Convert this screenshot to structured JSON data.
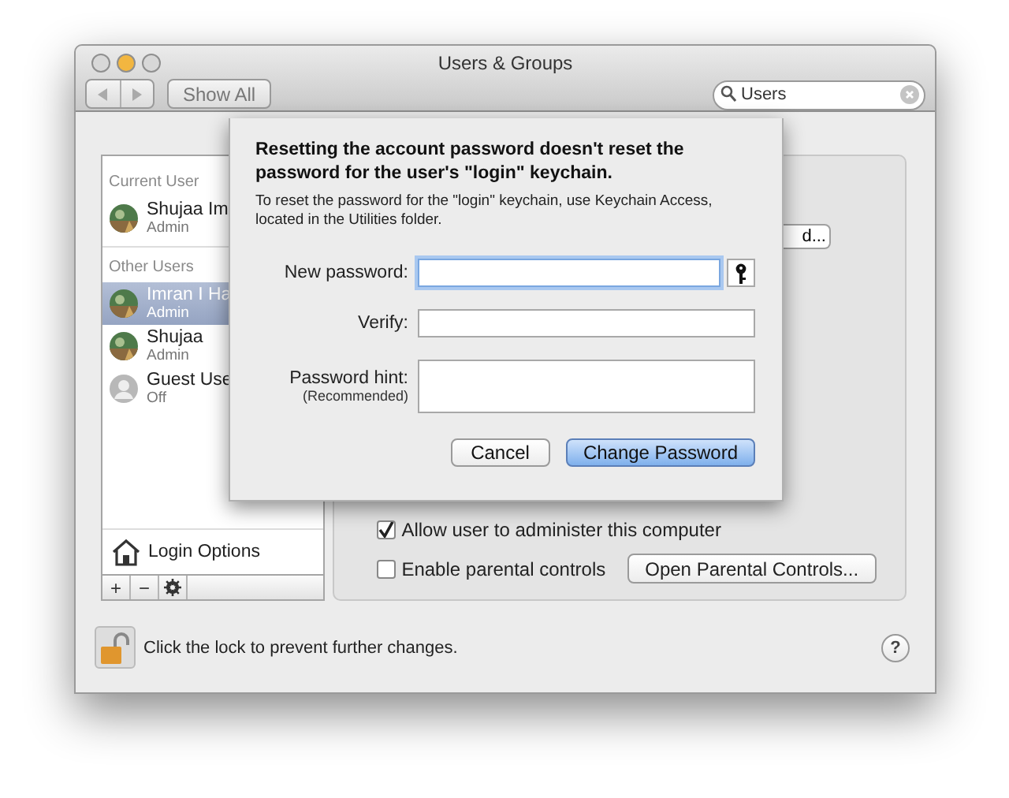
{
  "window": {
    "title": "Users & Groups"
  },
  "toolbar": {
    "show_all": "Show All",
    "search": {
      "value": "Users"
    }
  },
  "sidebar": {
    "sections": [
      {
        "heading": "Current User",
        "users": [
          {
            "name": "Shujaa Im",
            "role": "Admin",
            "selected": false
          }
        ]
      },
      {
        "heading": "Other Users",
        "users": [
          {
            "name": "Imran I Ha",
            "role": "Admin",
            "selected": true
          },
          {
            "name": "Shujaa",
            "role": "Admin",
            "selected": false
          },
          {
            "name": "Guest Use",
            "role": "Off",
            "selected": false,
            "kind": "guest"
          }
        ]
      }
    ],
    "login_options": "Login Options",
    "buttons": [
      "+",
      "−"
    ]
  },
  "panel": {
    "reset_button": "d...",
    "checkboxes": [
      {
        "label": "Allow user to administer this computer",
        "checked": true
      },
      {
        "label": "Enable parental controls",
        "checked": false,
        "button": "Open Parental Controls..."
      }
    ]
  },
  "footer": {
    "lock_text": "Click the lock to prevent further changes.",
    "locked": false,
    "help": "?"
  },
  "sheet": {
    "title": "Resetting the account password doesn't reset the password for the user's \"login\" keychain.",
    "message": "To reset the password for the \"login\" keychain, use Keychain Access, located in the Utilities folder.",
    "fields": [
      {
        "label": "New password:",
        "kind": "password",
        "focused": true,
        "assistant": true
      },
      {
        "label": "Verify:",
        "kind": "password",
        "focused": false
      },
      {
        "label": "Password hint:",
        "sublabel": "(Recommended)",
        "kind": "hint",
        "focused": false
      }
    ],
    "buttons": [
      {
        "label": "Cancel",
        "default": false
      },
      {
        "label": "Change Password",
        "default": true
      }
    ]
  }
}
